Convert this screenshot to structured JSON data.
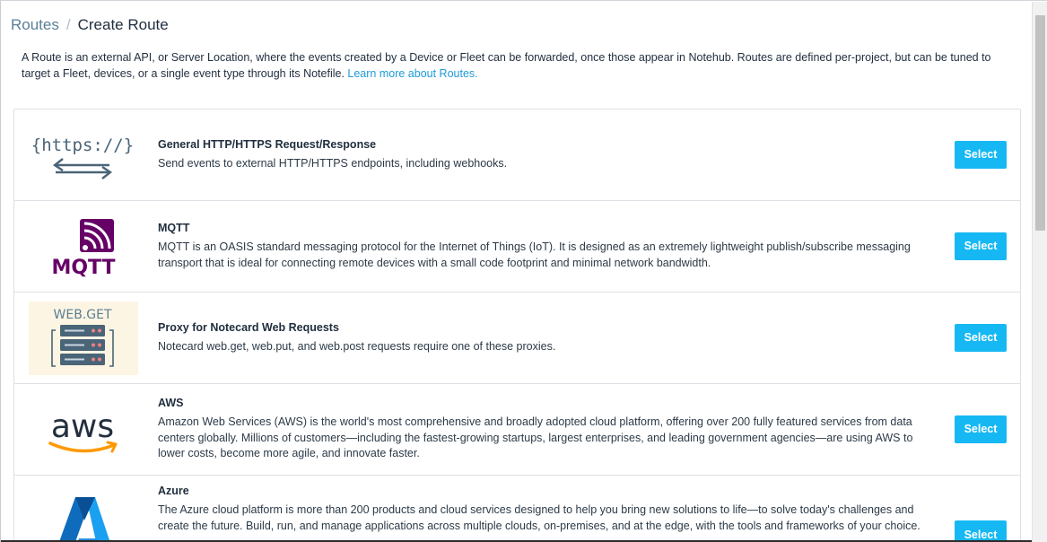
{
  "breadcrumb": {
    "parent": "Routes",
    "separator": "/",
    "current": "Create Route"
  },
  "intro": {
    "text": "A Route is an external API, or Server Location, where the events created by a Device or Fleet can be forwarded, once those appear in Notehub. Routes are defined per-project, but can be tuned to target a Fleet, devices, or a single event type through its Notefile.",
    "link": "Learn more about Routes."
  },
  "routes": [
    {
      "logo": "https-logo",
      "logo_text": "{https://}",
      "title": "General HTTP/HTTPS Request/Response",
      "description": "Send events to external HTTP/HTTPS endpoints, including webhooks.",
      "button": "Select"
    },
    {
      "logo": "mqtt-logo",
      "logo_text": "MQTT",
      "title": "MQTT",
      "description": "MQTT is an OASIS standard messaging protocol for the Internet of Things (IoT). It is designed as an extremely lightweight publish/subscribe messaging transport that is ideal for connecting remote devices with a small code footprint and minimal network bandwidth.",
      "button": "Select"
    },
    {
      "logo": "webget-logo",
      "logo_text": "WEB.GET",
      "title": "Proxy for Notecard Web Requests",
      "description": "Notecard web.get, web.put, and web.post requests require one of these proxies.",
      "button": "Select"
    },
    {
      "logo": "aws-logo",
      "logo_text": "aws",
      "title": "AWS",
      "description": "Amazon Web Services (AWS) is the world's most comprehensive and broadly adopted cloud platform, offering over 200 fully featured services from data centers globally. Millions of customers—including the fastest-growing startups, largest enterprises, and leading government agencies—are using AWS to lower costs, become more agile, and innovate faster.",
      "button": "Select"
    },
    {
      "logo": "azure-logo",
      "title": "Azure",
      "description": "The Azure cloud platform is more than 200 products and cloud services designed to help you bring new solutions to life—to solve today's challenges and create the future. Build, run, and manage applications across multiple clouds, on-premises, and at the edge, with the tools and frameworks of your choice.",
      "button": "Select"
    }
  ],
  "colors": {
    "accent": "#16b8f3",
    "link": "#1e9bd7",
    "mqtt": "#660066",
    "https_logo": "#4a6478",
    "aws_arrow": "#ff9900",
    "azure": "#0f6cbd"
  }
}
